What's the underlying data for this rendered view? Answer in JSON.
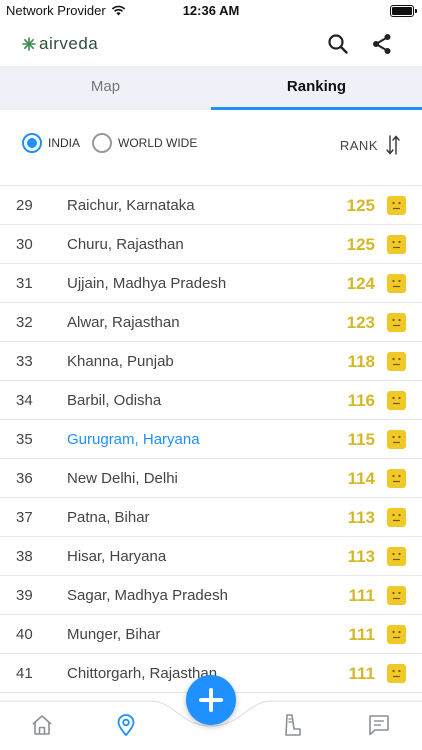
{
  "status_bar": {
    "carrier": "Network Provider",
    "time": "12:36 AM"
  },
  "app": {
    "logo_text": "airveda"
  },
  "icons": {
    "search": "search-icon",
    "share": "share-icon",
    "sort": "sort-arrows-icon",
    "face": "neutral-face-icon"
  },
  "tabs": [
    {
      "label": "Map",
      "active": false
    },
    {
      "label": "Ranking",
      "active": true
    }
  ],
  "filters": {
    "india_label": "INDIA",
    "world_label": "WORLD WIDE",
    "selected": "INDIA",
    "rank_label": "RANK"
  },
  "colors": {
    "accent": "#1e90ff",
    "aqi_moderate": "#d4b82a",
    "face_bg": "#f0c929"
  },
  "ranking": [
    {
      "rank": "29",
      "city": "Raichur, Karnataka",
      "aqi": "125",
      "highlight": false
    },
    {
      "rank": "30",
      "city": "Churu, Rajasthan",
      "aqi": "125",
      "highlight": false
    },
    {
      "rank": "31",
      "city": "Ujjain, Madhya Pradesh",
      "aqi": "124",
      "highlight": false
    },
    {
      "rank": "32",
      "city": "Alwar, Rajasthan",
      "aqi": "123",
      "highlight": false
    },
    {
      "rank": "33",
      "city": "Khanna, Punjab",
      "aqi": "118",
      "highlight": false
    },
    {
      "rank": "34",
      "city": "Barbil, Odisha",
      "aqi": "116",
      "highlight": false
    },
    {
      "rank": "35",
      "city": "Gurugram, Haryana",
      "aqi": "115",
      "highlight": true
    },
    {
      "rank": "36",
      "city": "New Delhi, Delhi",
      "aqi": "114",
      "highlight": false
    },
    {
      "rank": "37",
      "city": "Patna, Bihar",
      "aqi": "113",
      "highlight": false
    },
    {
      "rank": "38",
      "city": "Hisar, Haryana",
      "aqi": "113",
      "highlight": false
    },
    {
      "rank": "39",
      "city": "Sagar, Madhya Pradesh",
      "aqi": "111",
      "highlight": false
    },
    {
      "rank": "40",
      "city": "Munger, Bihar",
      "aqi": "111",
      "highlight": false
    },
    {
      "rank": "41",
      "city": "Chittorgarh, Rajasthan",
      "aqi": "111",
      "highlight": false
    }
  ],
  "bottom_nav": [
    {
      "icon": "home-icon"
    },
    {
      "icon": "location-pin-icon",
      "active": true
    },
    {
      "icon": "inhaler-icon"
    },
    {
      "icon": "chat-icon"
    }
  ]
}
